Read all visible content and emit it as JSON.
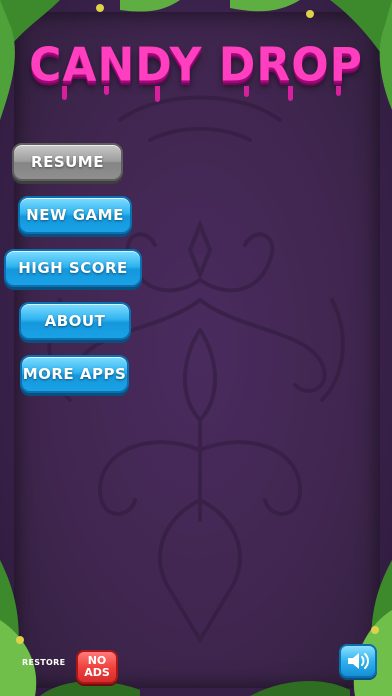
{
  "title": "CANDY DROP",
  "menu": {
    "resume": "RESUME",
    "new_game": "NEW GAME",
    "high_score": "HIGH SCORE",
    "about": "ABOUT",
    "more_apps": "MORE APPS"
  },
  "footer": {
    "restore_label": "RESTORE",
    "no_ads_line1": "NO",
    "no_ads_line2": "ADS",
    "sound_icon": "speaker-icon"
  },
  "colors": {
    "title": "#ff3fbf",
    "button_blue": "#2fb4f0",
    "button_gray": "#9d9d9d",
    "no_ads_red": "#f0433f",
    "background": "#40264f"
  }
}
